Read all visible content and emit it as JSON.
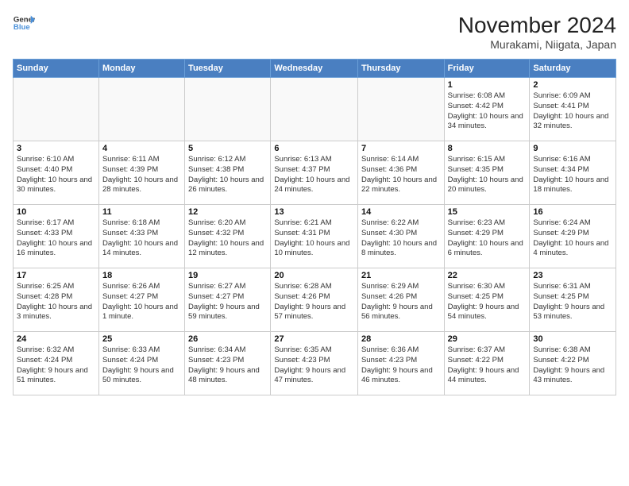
{
  "header": {
    "logo_line1": "General",
    "logo_line2": "Blue",
    "month_title": "November 2024",
    "location": "Murakami, Niigata, Japan"
  },
  "days_of_week": [
    "Sunday",
    "Monday",
    "Tuesday",
    "Wednesday",
    "Thursday",
    "Friday",
    "Saturday"
  ],
  "weeks": [
    [
      {
        "day": "",
        "info": ""
      },
      {
        "day": "",
        "info": ""
      },
      {
        "day": "",
        "info": ""
      },
      {
        "day": "",
        "info": ""
      },
      {
        "day": "",
        "info": ""
      },
      {
        "day": "1",
        "info": "Sunrise: 6:08 AM\nSunset: 4:42 PM\nDaylight: 10 hours and 34 minutes."
      },
      {
        "day": "2",
        "info": "Sunrise: 6:09 AM\nSunset: 4:41 PM\nDaylight: 10 hours and 32 minutes."
      }
    ],
    [
      {
        "day": "3",
        "info": "Sunrise: 6:10 AM\nSunset: 4:40 PM\nDaylight: 10 hours and 30 minutes."
      },
      {
        "day": "4",
        "info": "Sunrise: 6:11 AM\nSunset: 4:39 PM\nDaylight: 10 hours and 28 minutes."
      },
      {
        "day": "5",
        "info": "Sunrise: 6:12 AM\nSunset: 4:38 PM\nDaylight: 10 hours and 26 minutes."
      },
      {
        "day": "6",
        "info": "Sunrise: 6:13 AM\nSunset: 4:37 PM\nDaylight: 10 hours and 24 minutes."
      },
      {
        "day": "7",
        "info": "Sunrise: 6:14 AM\nSunset: 4:36 PM\nDaylight: 10 hours and 22 minutes."
      },
      {
        "day": "8",
        "info": "Sunrise: 6:15 AM\nSunset: 4:35 PM\nDaylight: 10 hours and 20 minutes."
      },
      {
        "day": "9",
        "info": "Sunrise: 6:16 AM\nSunset: 4:34 PM\nDaylight: 10 hours and 18 minutes."
      }
    ],
    [
      {
        "day": "10",
        "info": "Sunrise: 6:17 AM\nSunset: 4:33 PM\nDaylight: 10 hours and 16 minutes."
      },
      {
        "day": "11",
        "info": "Sunrise: 6:18 AM\nSunset: 4:33 PM\nDaylight: 10 hours and 14 minutes."
      },
      {
        "day": "12",
        "info": "Sunrise: 6:20 AM\nSunset: 4:32 PM\nDaylight: 10 hours and 12 minutes."
      },
      {
        "day": "13",
        "info": "Sunrise: 6:21 AM\nSunset: 4:31 PM\nDaylight: 10 hours and 10 minutes."
      },
      {
        "day": "14",
        "info": "Sunrise: 6:22 AM\nSunset: 4:30 PM\nDaylight: 10 hours and 8 minutes."
      },
      {
        "day": "15",
        "info": "Sunrise: 6:23 AM\nSunset: 4:29 PM\nDaylight: 10 hours and 6 minutes."
      },
      {
        "day": "16",
        "info": "Sunrise: 6:24 AM\nSunset: 4:29 PM\nDaylight: 10 hours and 4 minutes."
      }
    ],
    [
      {
        "day": "17",
        "info": "Sunrise: 6:25 AM\nSunset: 4:28 PM\nDaylight: 10 hours and 3 minutes."
      },
      {
        "day": "18",
        "info": "Sunrise: 6:26 AM\nSunset: 4:27 PM\nDaylight: 10 hours and 1 minute."
      },
      {
        "day": "19",
        "info": "Sunrise: 6:27 AM\nSunset: 4:27 PM\nDaylight: 9 hours and 59 minutes."
      },
      {
        "day": "20",
        "info": "Sunrise: 6:28 AM\nSunset: 4:26 PM\nDaylight: 9 hours and 57 minutes."
      },
      {
        "day": "21",
        "info": "Sunrise: 6:29 AM\nSunset: 4:26 PM\nDaylight: 9 hours and 56 minutes."
      },
      {
        "day": "22",
        "info": "Sunrise: 6:30 AM\nSunset: 4:25 PM\nDaylight: 9 hours and 54 minutes."
      },
      {
        "day": "23",
        "info": "Sunrise: 6:31 AM\nSunset: 4:25 PM\nDaylight: 9 hours and 53 minutes."
      }
    ],
    [
      {
        "day": "24",
        "info": "Sunrise: 6:32 AM\nSunset: 4:24 PM\nDaylight: 9 hours and 51 minutes."
      },
      {
        "day": "25",
        "info": "Sunrise: 6:33 AM\nSunset: 4:24 PM\nDaylight: 9 hours and 50 minutes."
      },
      {
        "day": "26",
        "info": "Sunrise: 6:34 AM\nSunset: 4:23 PM\nDaylight: 9 hours and 48 minutes."
      },
      {
        "day": "27",
        "info": "Sunrise: 6:35 AM\nSunset: 4:23 PM\nDaylight: 9 hours and 47 minutes."
      },
      {
        "day": "28",
        "info": "Sunrise: 6:36 AM\nSunset: 4:23 PM\nDaylight: 9 hours and 46 minutes."
      },
      {
        "day": "29",
        "info": "Sunrise: 6:37 AM\nSunset: 4:22 PM\nDaylight: 9 hours and 44 minutes."
      },
      {
        "day": "30",
        "info": "Sunrise: 6:38 AM\nSunset: 4:22 PM\nDaylight: 9 hours and 43 minutes."
      }
    ]
  ]
}
